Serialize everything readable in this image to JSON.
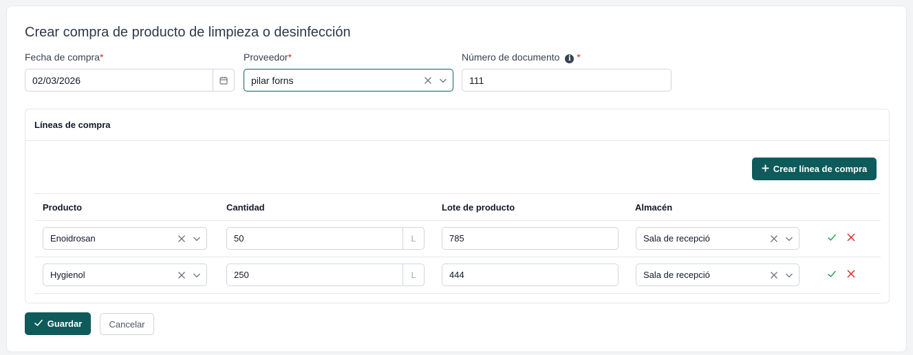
{
  "page": {
    "title": "Crear compra de producto de limpieza o desinfección"
  },
  "form": {
    "fecha": {
      "label": "Fecha de compra",
      "required_mark": "*",
      "value": "02/03/2026"
    },
    "proveedor": {
      "label": "Proveedor",
      "required_mark": "*",
      "value": "pilar forns"
    },
    "documento": {
      "label": "Número de documento",
      "required_mark": "*",
      "value": "111"
    }
  },
  "lines": {
    "title": "Líneas de compra",
    "create_button": "Crear línea de compra",
    "columns": [
      "Producto",
      "Cantidad",
      "Lote de producto",
      "Almacén"
    ],
    "rows": [
      {
        "producto": "Enoidrosan",
        "cantidad": "50",
        "unidad": "L",
        "lote": "785",
        "almacen": "Sala de recepció"
      },
      {
        "producto": "Hygienol",
        "cantidad": "250",
        "unidad": "L",
        "lote": "444",
        "almacen": "Sala de recepció"
      }
    ]
  },
  "actions": {
    "save": "Guardar",
    "cancel": "Cancelar"
  },
  "colors": {
    "primary": "#0f5a5b",
    "confirm": "#22a34a",
    "danger": "#dc2626",
    "required": "#dc2626"
  }
}
